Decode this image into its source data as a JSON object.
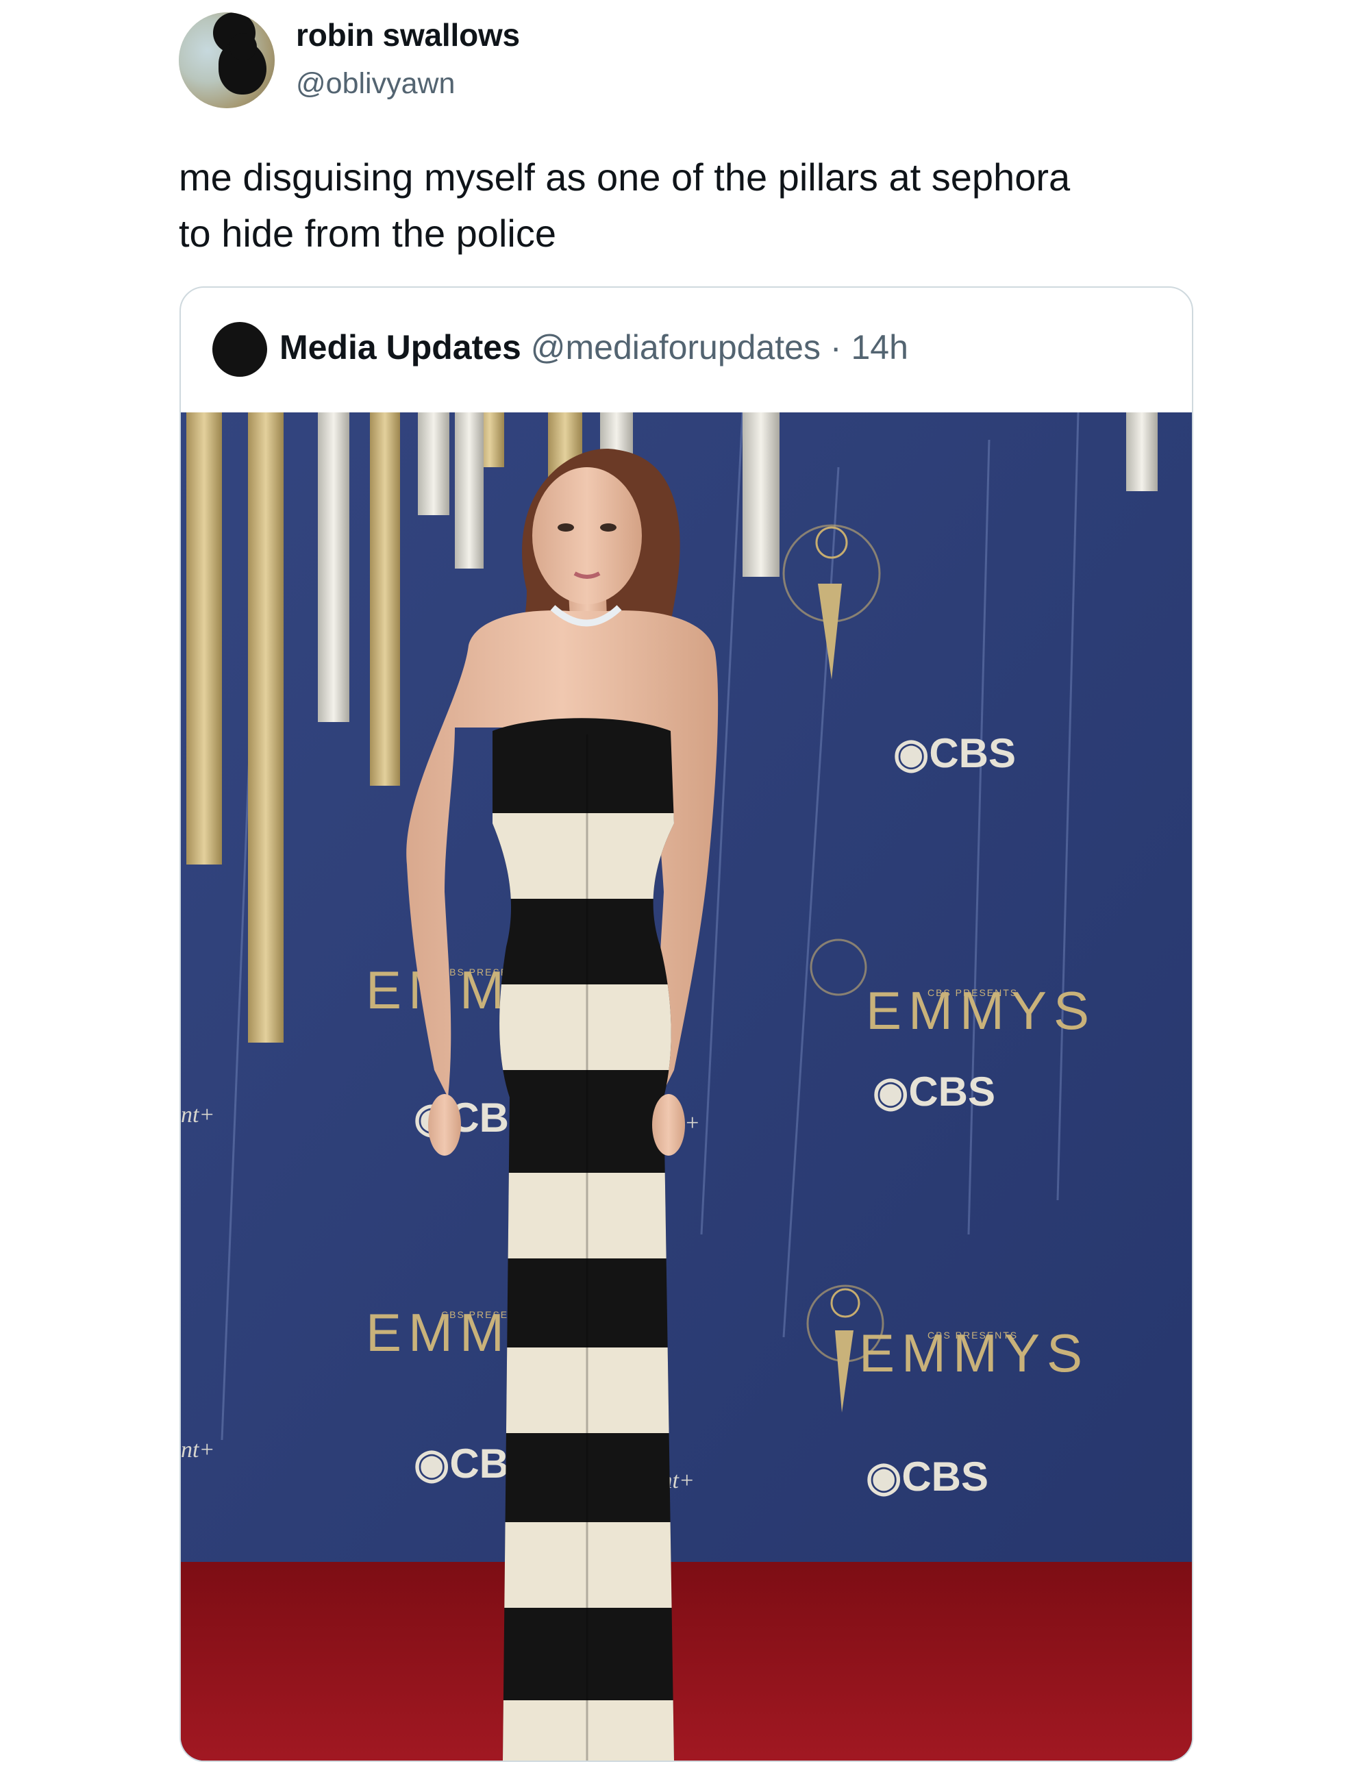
{
  "tweet": {
    "author": {
      "display_name": "robin swallows",
      "handle": "@oblivyawn"
    },
    "text_line1": "me disguising myself as one of the pillars at sephora",
    "text_line2": "to hide from the police"
  },
  "quoted_tweet": {
    "author": {
      "display_name": "Media Updates",
      "handle": "@mediaforupdates"
    },
    "separator": "·",
    "time": "14h",
    "photo": {
      "backdrop_logos": [
        "EMMYS",
        "CBS",
        "CBS PRESENTS",
        "Paramount+"
      ],
      "colors": {
        "backdrop": "#2e3f7c",
        "gold": "#c9b27a",
        "carpet": "#8e1119",
        "dress_black": "#141414",
        "dress_cream": "#ece5d3"
      }
    }
  }
}
